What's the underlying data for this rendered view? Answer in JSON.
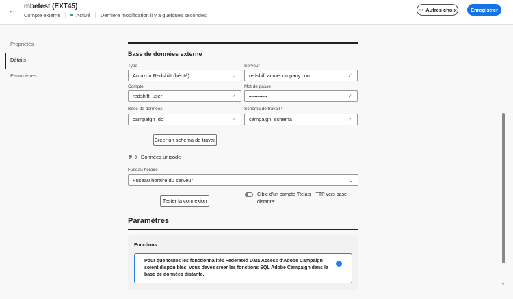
{
  "header": {
    "title": "mbetest (EXT45)",
    "type": "Compte externe",
    "status": "Activé",
    "modified": "Dernière modification il y a quelques secondes",
    "more_label": "Autres choix",
    "save_label": "Enregistrer",
    "back_icon": "arrow-left-icon"
  },
  "nav": {
    "items": [
      {
        "label": "Propriétés"
      },
      {
        "label": "Détails"
      },
      {
        "label": "Paramètres"
      }
    ]
  },
  "section": {
    "title": "Base de données externe",
    "type": {
      "label": "Type",
      "value": "Amazon Redshift (hérité)"
    },
    "server": {
      "label": "Serveur",
      "value": "redshift.acmecompany.com"
    },
    "account": {
      "label": "Compte",
      "value": "redshift_user"
    },
    "password": {
      "label": "Mot de passe",
      "value": "•••••••••••••••"
    },
    "database": {
      "label": "Base de données",
      "value": "campaign_db"
    },
    "schema": {
      "label": "Schéma de travail",
      "required": "*",
      "value": "campaign_schema"
    },
    "create_schema": "Créer un schéma de travail",
    "unicode": "Données unicode",
    "timezone": {
      "label": "Fuseau horaire",
      "value": "Fuseau horaire du serveur"
    },
    "test": "Tester la connexion",
    "relay": "Cible d'un compte 'Relais HTTP vers base distante'"
  },
  "params": {
    "title": "Paramètres",
    "functions": "Fonctions",
    "info": "Pour que toutes les fonctionnalités Federated Data Access d'Adobe Campaign soient disponibles, vous devez créer les fonctions SQL Adobe Campaign dans la base de données distante."
  }
}
